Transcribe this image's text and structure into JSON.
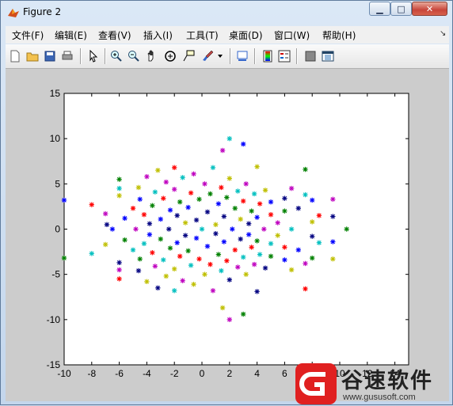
{
  "window": {
    "title": "Figure 2",
    "minimize": "▁",
    "maximize": "□",
    "close": "✕"
  },
  "menu": [
    "文件(F)",
    "编辑(E)",
    "查看(V)",
    "插入(I)",
    "工具(T)",
    "桌面(D)",
    "窗口(W)",
    "帮助(H)"
  ],
  "toolbar": [
    "new-figure-icon",
    "open-file-icon",
    "save-icon",
    "print-icon",
    "pointer-icon",
    "zoom-in-icon",
    "zoom-out-icon",
    "pan-hand-icon",
    "rotate-3d-icon",
    "data-cursor-icon",
    "brush-icon",
    "link-plot-icon",
    "colorbar-icon",
    "legend-icon",
    "hide-plot-tools-icon",
    "show-plot-tools-icon"
  ],
  "watermark": {
    "text": "谷速软件",
    "url": "www.gususoft.com"
  },
  "chart_data": {
    "type": "scatter",
    "marker": "*",
    "xlim": [
      -10,
      15
    ],
    "ylim": [
      -15,
      15
    ],
    "xticks": [
      "-10",
      "-8",
      "-6",
      "-4",
      "-2",
      "0",
      "2",
      "4",
      "6",
      "8",
      "10",
      "12",
      "14"
    ],
    "yticks": [
      "15",
      "10",
      "5",
      "0",
      "-5",
      "-10",
      "-15"
    ],
    "colors": [
      "#0000ff",
      "#008000",
      "#ff0000",
      "#00bfbf",
      "#bf00bf",
      "#bfbf00",
      "#000080"
    ],
    "series": [
      {
        "values": [
          [
            -10,
            3.2
          ],
          [
            -10,
            -3.2
          ],
          [
            -8,
            2.7
          ],
          [
            -8,
            -2.7
          ],
          [
            -7,
            1.7
          ],
          [
            -7,
            -1.7
          ],
          [
            -6.9,
            0.5
          ],
          [
            -6.5,
            0
          ],
          [
            -6,
            5.5
          ],
          [
            -6,
            -5.5
          ],
          [
            -6,
            4.5
          ],
          [
            -6,
            -4.5
          ],
          [
            -6,
            3.7
          ],
          [
            -6,
            -3.7
          ],
          [
            -5.6,
            1.2
          ],
          [
            -5.6,
            -1.2
          ],
          [
            -5,
            2.3
          ],
          [
            -5,
            -2.3
          ],
          [
            -4.8,
            0
          ],
          [
            -4.6,
            4.6
          ],
          [
            -4.6,
            -4.6
          ],
          [
            -4.5,
            3.3
          ],
          [
            -4.5,
            -3.3
          ],
          [
            -4.2,
            1.6
          ],
          [
            -4.2,
            -1.6
          ],
          [
            -4,
            5.8
          ],
          [
            -4,
            -5.8
          ],
          [
            -3.8,
            0.6
          ],
          [
            -3.8,
            -0.6
          ],
          [
            -3.6,
            2.6
          ],
          [
            -3.6,
            -2.6
          ],
          [
            -3.4,
            4.1
          ],
          [
            -3.4,
            -4.1
          ],
          [
            -3.2,
            6.5
          ],
          [
            -3.2,
            -6.5
          ],
          [
            -3,
            1.1
          ],
          [
            -3,
            -1.1
          ],
          [
            -2.8,
            3.4
          ],
          [
            -2.8,
            -3.4
          ],
          [
            -2.6,
            5.2
          ],
          [
            -2.6,
            -5.2
          ],
          [
            -2.4,
            0
          ],
          [
            -2.3,
            2.1
          ],
          [
            -2.3,
            -2.1
          ],
          [
            -2,
            6.8
          ],
          [
            -2,
            -6.8
          ],
          [
            -2,
            4.4
          ],
          [
            -2,
            -4.4
          ],
          [
            -1.8,
            1.5
          ],
          [
            -1.8,
            -1.5
          ],
          [
            -1.6,
            3.0
          ],
          [
            -1.6,
            -3.0
          ],
          [
            -1.4,
            5.7
          ],
          [
            -1.4,
            -5.7
          ],
          [
            -1.2,
            0.7
          ],
          [
            -1.2,
            -0.7
          ],
          [
            -1,
            2.4
          ],
          [
            -1,
            -2.4
          ],
          [
            -0.8,
            4.0
          ],
          [
            -0.8,
            -4.0
          ],
          [
            -0.6,
            6.1
          ],
          [
            -0.6,
            -6.1
          ],
          [
            -0.4,
            1.0
          ],
          [
            -0.4,
            -1.0
          ],
          [
            -0.2,
            3.3
          ],
          [
            -0.2,
            -3.3
          ],
          [
            0,
            0
          ],
          [
            0.2,
            5.0
          ],
          [
            0.2,
            -5.0
          ],
          [
            0.4,
            1.9
          ],
          [
            0.4,
            -1.9
          ],
          [
            0.6,
            3.9
          ],
          [
            0.6,
            -3.9
          ],
          [
            0.8,
            6.8
          ],
          [
            0.8,
            -6.8
          ],
          [
            1,
            0.5
          ],
          [
            1,
            -0.5
          ],
          [
            1.2,
            2.8
          ],
          [
            1.2,
            -2.8
          ],
          [
            1.4,
            4.6
          ],
          [
            1.4,
            -4.6
          ],
          [
            1.5,
            8.7
          ],
          [
            1.5,
            -8.7
          ],
          [
            1.6,
            1.4
          ],
          [
            1.6,
            -1.4
          ],
          [
            1.8,
            3.5
          ],
          [
            1.8,
            -3.5
          ],
          [
            2,
            10
          ],
          [
            2,
            -10
          ],
          [
            2,
            5.6
          ],
          [
            2,
            -5.6
          ],
          [
            2.2,
            0
          ],
          [
            2.4,
            2.3
          ],
          [
            2.4,
            -2.3
          ],
          [
            2.6,
            4.2
          ],
          [
            2.6,
            -4.2
          ],
          [
            2.8,
            1.1
          ],
          [
            2.8,
            -1.1
          ],
          [
            3,
            9.4
          ],
          [
            3,
            -9.4
          ],
          [
            3,
            3.1
          ],
          [
            3,
            -3.1
          ],
          [
            3.2,
            5.0
          ],
          [
            3.2,
            -5.0
          ],
          [
            3.4,
            0.6
          ],
          [
            3.4,
            -0.6
          ],
          [
            3.6,
            2.0
          ],
          [
            3.6,
            -2.0
          ],
          [
            3.8,
            3.9
          ],
          [
            3.8,
            -3.9
          ],
          [
            4,
            6.9
          ],
          [
            4,
            -6.9
          ],
          [
            4,
            1.3
          ],
          [
            4,
            -1.3
          ],
          [
            4.2,
            2.8
          ],
          [
            4.2,
            -2.8
          ],
          [
            4.5,
            0
          ],
          [
            4.6,
            4.3
          ],
          [
            4.6,
            -4.3
          ],
          [
            5,
            3.0
          ],
          [
            5,
            -3.0
          ],
          [
            5,
            1.6
          ],
          [
            5,
            -1.6
          ],
          [
            5.5,
            0.7
          ],
          [
            5.5,
            -0.7
          ],
          [
            6,
            3.4
          ],
          [
            6,
            -3.4
          ],
          [
            6,
            2.0
          ],
          [
            6,
            -2.0
          ],
          [
            6.5,
            0
          ],
          [
            6.5,
            4.5
          ],
          [
            6.5,
            -4.5
          ],
          [
            7,
            2.3
          ],
          [
            7,
            -2.3
          ],
          [
            7.5,
            6.6
          ],
          [
            7.5,
            -6.6
          ],
          [
            7.5,
            3.8
          ],
          [
            7.5,
            -3.8
          ],
          [
            8,
            0.8
          ],
          [
            8,
            -0.8
          ],
          [
            8,
            3.2
          ],
          [
            8,
            -3.2
          ],
          [
            8.5,
            1.5
          ],
          [
            8.5,
            -1.5
          ],
          [
            9.5,
            3.3
          ],
          [
            9.5,
            -3.3
          ],
          [
            9.5,
            1.4
          ],
          [
            9.5,
            -1.4
          ],
          [
            10.5,
            0
          ]
        ]
      }
    ]
  }
}
